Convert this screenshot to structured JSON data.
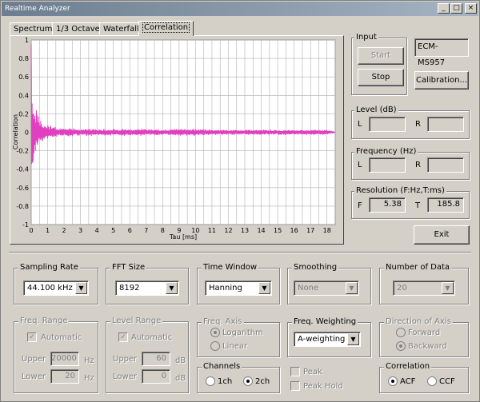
{
  "window": {
    "title": "Realtime Analyzer",
    "minimize": "_",
    "maximize": "□",
    "close": "×"
  },
  "tabs": [
    "Spectrum",
    "1/3 Octave",
    "Waterfall",
    "Correlation"
  ],
  "device": "ECM-MS957",
  "input": {
    "label": "Input",
    "start": "Start",
    "stop": "Stop",
    "calibration": "Calibration..."
  },
  "level": {
    "label": "Level (dB)",
    "l": "L",
    "r": "R",
    "l_value": "",
    "r_value": ""
  },
  "frequency": {
    "label": "Frequency (Hz)",
    "l": "L",
    "r": "R",
    "l_value": "",
    "r_value": ""
  },
  "resolution": {
    "label": "Resolution (F:Hz,T:ms)",
    "f": "F",
    "t": "T",
    "f_value": "5.38",
    "t_value": "185.8"
  },
  "exit": "Exit",
  "sampling_rate": {
    "label": "Sampling Rate",
    "value": "44.100 kHz"
  },
  "fft_size": {
    "label": "FFT Size",
    "value": "8192"
  },
  "time_window": {
    "label": "Time Window",
    "value": "Hanning"
  },
  "smoothing": {
    "label": "Smoothing",
    "value": "None"
  },
  "number_of_data": {
    "label": "Number of Data",
    "value": "20"
  },
  "freq_range": {
    "label": "Freq. Range",
    "automatic": "Automatic",
    "upper": "Upper",
    "lower": "Lower",
    "upper_value": "20000",
    "lower_value": "20",
    "unit": "Hz"
  },
  "level_range": {
    "label": "Level Range",
    "automatic": "Automatic",
    "upper": "Upper",
    "lower": "Lower",
    "upper_value": "60",
    "lower_value": "0",
    "unit": "dB"
  },
  "freq_axis": {
    "label": "Freq. Axis",
    "logarithm": "Logarithm",
    "linear": "Linear"
  },
  "freq_weighting": {
    "label": "Freq. Weighting",
    "value": "A-weighting"
  },
  "direction_of_axis": {
    "label": "Direction of Axis",
    "forward": "Forward",
    "backward": "Backward"
  },
  "channels": {
    "label": "Channels",
    "ch1": "1ch",
    "ch2": "2ch"
  },
  "peak": {
    "peak": "Peak",
    "peak_hold": "Peak Hold"
  },
  "correlation": {
    "label": "Correlation",
    "acf": "ACF",
    "ccf": "CCF"
  },
  "chart_data": {
    "type": "line",
    "title": "",
    "xlabel": "Tau [ms]",
    "ylabel": "Correlation",
    "xlim": [
      0,
      18.5
    ],
    "ylim": [
      -1,
      1
    ],
    "x_ticks": [
      "0",
      "1",
      "2",
      "3",
      "4",
      "5",
      "6",
      "7",
      "8",
      "9",
      "10",
      "11",
      "12",
      "13",
      "14",
      "15",
      "16",
      "17",
      "18"
    ],
    "y_ticks": [
      "1",
      "0.8",
      "0.6",
      "0.4",
      "0.2",
      "0",
      "-0.2",
      "-0.4",
      "-0.6",
      "-0.8",
      "-1"
    ],
    "grid": true,
    "line_color": "#e040c0",
    "series": [
      {
        "x": [
          0,
          0.05,
          0.1,
          0.2,
          0.3,
          0.5,
          0.8,
          1.0,
          1.5,
          2,
          3,
          4,
          5,
          6,
          7,
          8,
          9,
          10,
          11,
          12,
          13,
          14,
          15,
          16,
          17,
          18,
          18.5
        ],
        "values": [
          0.95,
          -0.6,
          0.45,
          -0.3,
          0.25,
          -0.15,
          0.1,
          -0.08,
          0.06,
          -0.05,
          0.04,
          -0.04,
          0.04,
          0.04,
          -0.04,
          0.03,
          -0.04,
          0.04,
          -0.03,
          0.03,
          -0.03,
          0.03,
          -0.03,
          0.03,
          -0.03,
          0.03,
          0.0
        ]
      }
    ]
  }
}
